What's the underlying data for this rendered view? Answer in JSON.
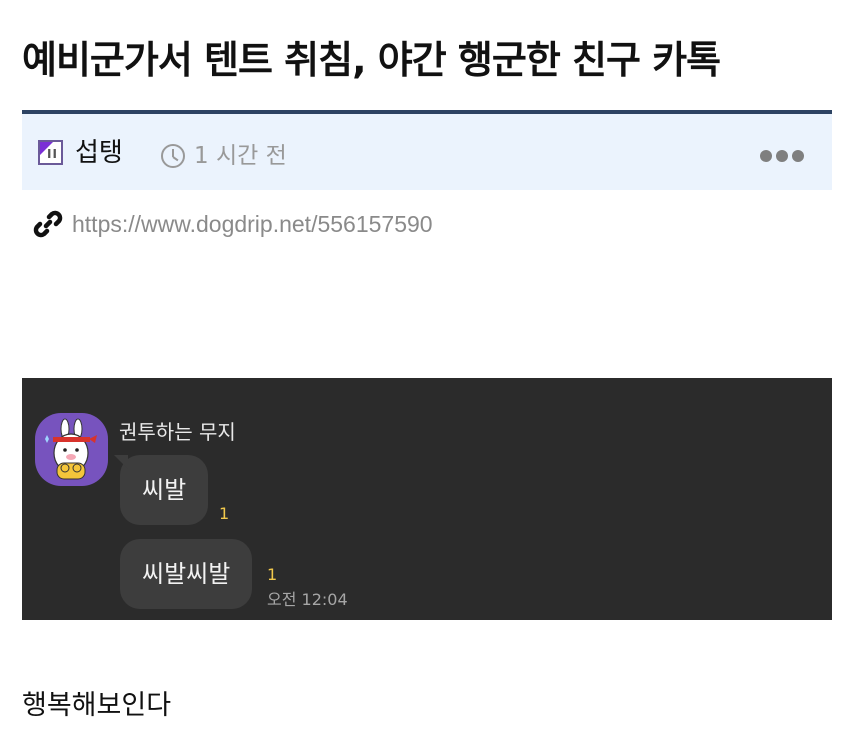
{
  "post": {
    "title": "예비군가서 텐트 취침, 야간 행군한 친구 카톡",
    "category": "섭탱",
    "time": "1 시간 전",
    "url": "https://www.dogdrip.net/556157590",
    "body": "행복해보인다"
  },
  "icons": {
    "category": "category-icon",
    "clock": "clock-icon",
    "more": "more-icon",
    "link": "link-icon",
    "avatar": "rabbit-avatar"
  },
  "chat": {
    "sender": "권투하는 무지",
    "messages": [
      {
        "text": "씨발",
        "unread": "1"
      },
      {
        "text": "씨발씨발",
        "unread": "1",
        "time": "오전 12:04"
      }
    ]
  },
  "colors": {
    "accent_border": "#2d4363",
    "meta_bg": "#ebf3fd",
    "chat_bg": "#2b2b2b",
    "bubble": "#3d3d3d",
    "avatar_bg": "#7753be",
    "unread": "#f2c94c"
  }
}
